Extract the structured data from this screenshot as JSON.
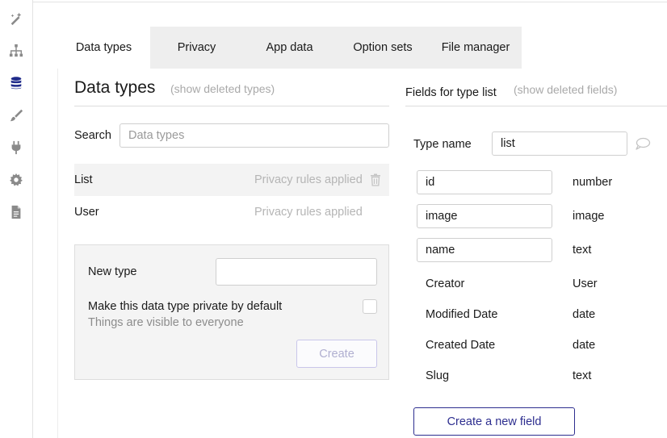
{
  "sidebar": {
    "icons": [
      "design-icon",
      "workflow-icon",
      "data-icon",
      "styles-icon",
      "plugins-icon",
      "settings-icon",
      "logs-icon"
    ]
  },
  "tabs": [
    "Data types",
    "Privacy",
    "App data",
    "Option sets",
    "File manager"
  ],
  "left": {
    "title": "Data types",
    "show_deleted": "(show deleted types)",
    "search_label": "Search",
    "search_placeholder": "Data types",
    "types": [
      {
        "name": "List",
        "rules": "Privacy rules applied"
      },
      {
        "name": "User",
        "rules": "Privacy rules applied"
      }
    ],
    "new_type": {
      "label": "New type",
      "private_label": "Make this data type private by default",
      "visibility_note": "Things are visible to everyone",
      "create_label": "Create"
    }
  },
  "right": {
    "title": "Fields for type list",
    "show_deleted": "(show deleted fields)",
    "type_name_label": "Type name",
    "type_name_value": "list",
    "editable_fields": [
      {
        "name": "id",
        "type": "number"
      },
      {
        "name": "image",
        "type": "image"
      },
      {
        "name": "name",
        "type": "text"
      }
    ],
    "builtin_fields": [
      {
        "name": "Creator",
        "type": "User"
      },
      {
        "name": "Modified Date",
        "type": "date"
      },
      {
        "name": "Created Date",
        "type": "date"
      },
      {
        "name": "Slug",
        "type": "text"
      }
    ],
    "create_field_label": "Create a new field"
  },
  "colors": {
    "accent": "#2d2e8f",
    "active_sidebar_icon": "#1f2a8a",
    "muted_text": "#a9a9a9"
  }
}
